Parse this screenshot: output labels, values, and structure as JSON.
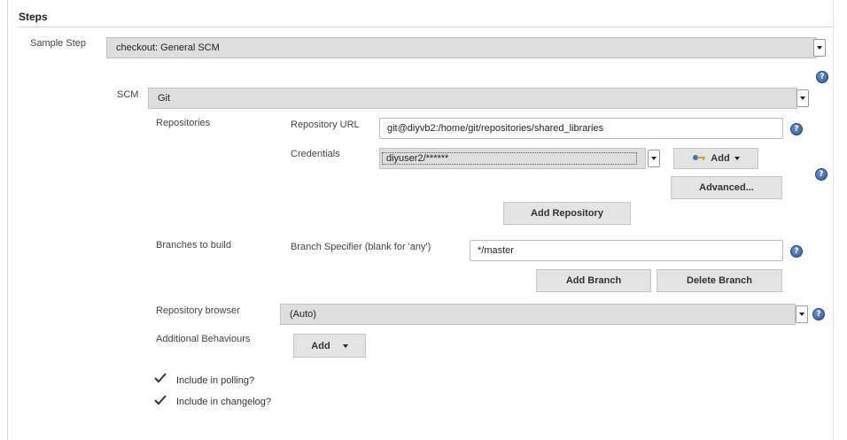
{
  "steps": {
    "title": "Steps",
    "sample_step_label": "Sample Step",
    "sample_step_value": "checkout: General SCM"
  },
  "scm": {
    "label": "SCM",
    "value": "Git",
    "repositories": {
      "label": "Repositories",
      "url_label": "Repository URL",
      "url_value": "git@diyvb2:/home/git/repositories/shared_libraries",
      "credentials_label": "Credentials",
      "credentials_value": "diyuser2/******",
      "add_label": "Add",
      "advanced_label": "Advanced...",
      "add_repository_label": "Add Repository"
    },
    "branches": {
      "label": "Branches to build",
      "specifier_label": "Branch Specifier (blank for 'any')",
      "specifier_value": "*/master",
      "add_branch_label": "Add Branch",
      "delete_branch_label": "Delete Branch"
    },
    "repository_browser": {
      "label": "Repository browser",
      "value": "(Auto)"
    },
    "additional_behaviours": {
      "label": "Additional Behaviours",
      "add_label": "Add"
    },
    "include_polling": {
      "label": "Include in polling?",
      "checked": true
    },
    "include_changelog": {
      "label": "Include in changelog?",
      "checked": true
    }
  },
  "icons": {
    "help": "help-icon",
    "dropdown": "chevron-down-icon",
    "key": "key-icon",
    "check": "check-icon"
  },
  "colors": {
    "help_blue": "#2c5a9c",
    "select_bg": "#dedede",
    "button_bg": "#e4e4e4"
  }
}
